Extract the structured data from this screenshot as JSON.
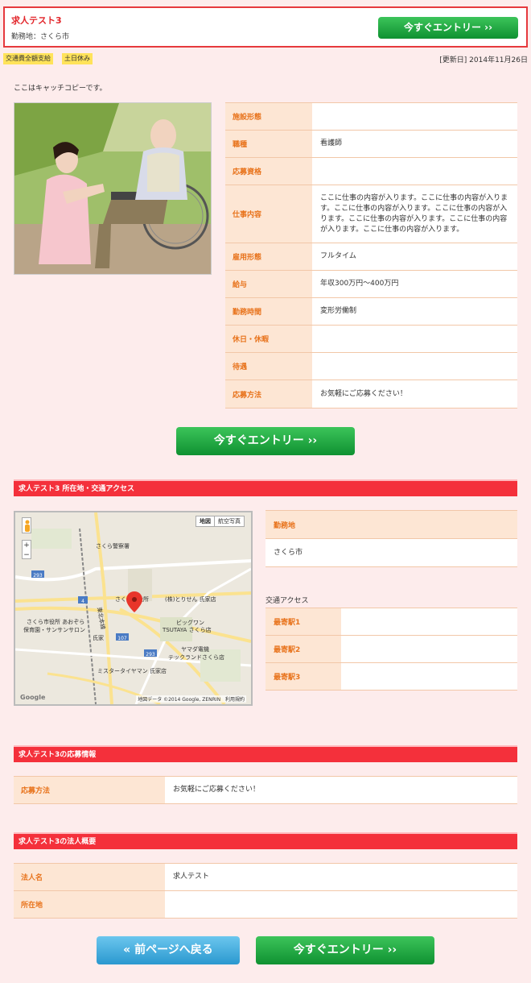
{
  "header": {
    "job_title": "求人テスト3",
    "work_location": "勤務地：さくら市",
    "entry_label": "今すぐエントリー ››"
  },
  "tags": [
    "交通費全額支給",
    "土日休み"
  ],
  "updated": "[更新日] 2014年11月26日",
  "catch_copy": "ここはキャッチコピーです。",
  "details": [
    {
      "label": "施設形態",
      "value": ""
    },
    {
      "label": "職種",
      "value": "看護師"
    },
    {
      "label": "応募資格",
      "value": ""
    },
    {
      "label": "仕事内容",
      "value": "ここに仕事の内容が入ります。ここに仕事の内容が入ります。ここに仕事の内容が入ります。ここに仕事の内容が入ります。ここに仕事の内容が入ります。ここに仕事の内容が入ります。ここに仕事の内容が入ります。"
    },
    {
      "label": "雇用形態",
      "value": "フルタイム"
    },
    {
      "label": "給与",
      "value": "年収300万円～400万円"
    },
    {
      "label": "勤務時間",
      "value": "変形労働制"
    },
    {
      "label": "休日・休暇",
      "value": ""
    },
    {
      "label": "待遇",
      "value": ""
    },
    {
      "label": "応募方法",
      "value": "お気軽にご応募ください！"
    }
  ],
  "entry_big_label": "今すぐエントリー ››",
  "access_section": {
    "title": "求人テスト3 所在地・交通アクセス",
    "location_label": "勤務地",
    "location_value": "さくら市",
    "access_heading": "交通アクセス",
    "stations": [
      {
        "label": "最寄駅1",
        "value": ""
      },
      {
        "label": "最寄駅2",
        "value": ""
      },
      {
        "label": "最寄駅3",
        "value": ""
      }
    ]
  },
  "map": {
    "map_btn": "地図",
    "satellite_btn": "航空写真",
    "zoom_in": "+",
    "zoom_out": "−",
    "copyright": "地図データ ©2014 Google, ZENRIN",
    "terms": "利用規約",
    "labels": {
      "police": "さくら警察署",
      "cityhall": "さくら市役所",
      "torisen": "(株)とりせん 氏家店",
      "bigwan": "ビッグワン",
      "tsutaya": "TSUTAYA さくら店",
      "yamada1": "ヤマダ電機",
      "yamada2": "テックランドさくら店",
      "cityhall_aozora": "さくら市役所 あおぞら",
      "nursery": "保育園・サンサンサロン",
      "ujiie": "氏家",
      "mister": "ミスタータイヤマン 氏家店",
      "tohoku": "東北本線",
      "r293a": "293",
      "r293b": "293",
      "r4": "4",
      "r107": "107"
    }
  },
  "apply_section": {
    "title": "求人テスト3の応募情報",
    "label": "応募方法",
    "value": "お気軽にご応募ください！"
  },
  "corp_section": {
    "title": "求人テスト3の法人概要",
    "rows": [
      {
        "label": "法人名",
        "value": "求人テスト"
      },
      {
        "label": "所在地",
        "value": ""
      }
    ]
  },
  "footer": {
    "back_label": "« 前ページへ戻る",
    "entry_label": "今すぐエントリー ››"
  },
  "colors": {
    "accent": "#e2262b",
    "entry_green": "#1fa63f",
    "label_bg": "#fde6d4",
    "label_text": "#e8731c"
  }
}
